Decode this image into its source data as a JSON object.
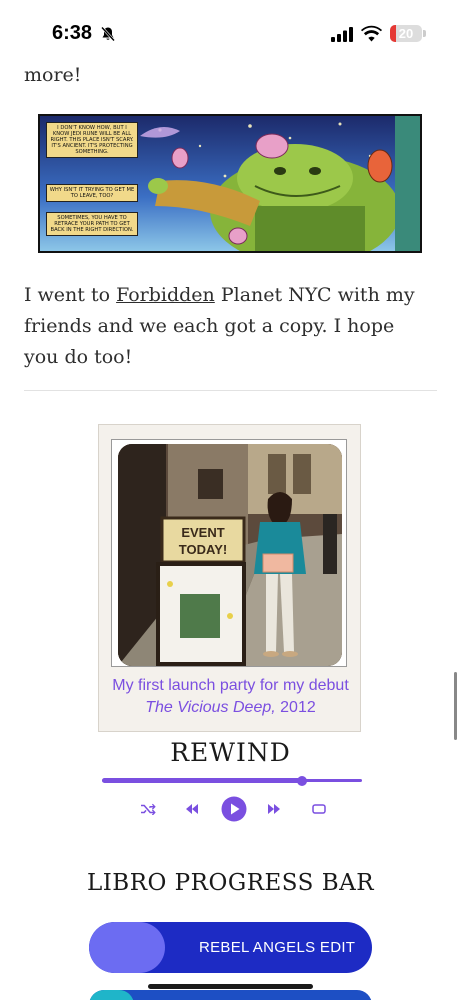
{
  "status_bar": {
    "time": "6:38",
    "battery_level": "20",
    "battery_fraction": 0.2,
    "icons": [
      "bell-slash-icon",
      "signal-icon",
      "wifi-icon",
      "battery-icon"
    ]
  },
  "article": {
    "top_text": "more!",
    "comic": {
      "captions": [
        "I don't know how, but I know Jedi Rune will be all right. This place isn't scary. It's ancient. It's protecting something.",
        "Why isn't it trying to get me to leave, too?",
        "Sometimes, you have to retrace your path to get back in the right direction."
      ]
    },
    "paragraph": {
      "before_link": "I went to ",
      "link": "Forbidden",
      "after_link": " Planet NYC with my friends and we each got a copy. I hope you do too!"
    }
  },
  "photo_card": {
    "sign_text_line1": "EVENT",
    "sign_text_line2": "TODAY!",
    "caption_prefix": "My first launch party for my debut ",
    "caption_title": "The Vicious Deep,",
    "caption_year": " 2012"
  },
  "rewind": {
    "title": "REWIND",
    "progress": 0.77,
    "controls": [
      "shuffle-icon",
      "previous-icon",
      "play-icon",
      "next-icon",
      "repeat-icon"
    ],
    "accent_color": "#7a4fe0"
  },
  "libro": {
    "title": "LIBRO PROGRESS BAR",
    "bars": [
      {
        "label": "REBEL ANGELS EDIT",
        "progress": 0.27,
        "track_color": "#1d2bc4",
        "fill_color": "#6c6cf2"
      },
      {
        "label": "",
        "progress": 0.16,
        "track_color": "#1d4fc4",
        "fill_color": "#1fb5c9"
      }
    ]
  }
}
